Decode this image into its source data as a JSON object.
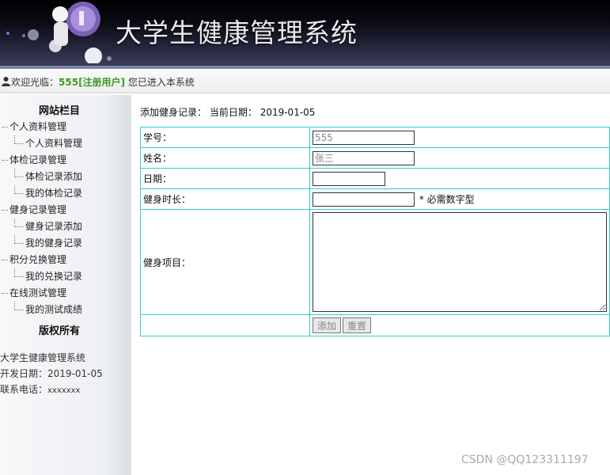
{
  "header": {
    "title": "大学生健康管理系统"
  },
  "welcome": {
    "prefix": "欢迎光临：",
    "user": "555[注册用户]",
    "suffix": " 您已进入本系统"
  },
  "sidebar": {
    "heading": "网站栏目",
    "groups": [
      {
        "label": "个人资料管理",
        "items": [
          "个人资料管理"
        ]
      },
      {
        "label": "体检记录管理",
        "items": [
          "体检记录添加",
          "我的体检记录"
        ]
      },
      {
        "label": "健身记录管理",
        "items": [
          "健身记录添加",
          "我的健身记录"
        ]
      },
      {
        "label": "积分兑换管理",
        "items": [
          "我的兑换记录"
        ]
      },
      {
        "label": "在线测试管理",
        "items": [
          "我的测试成绩"
        ]
      }
    ],
    "copyright_heading": "版权所有",
    "system_name": "大学生健康管理系统",
    "dev_date_label": "开发日期：",
    "dev_date": "2019-01-05",
    "phone_label": "联系电话：",
    "phone": "xxxxxxx"
  },
  "main": {
    "page_title": "添加健身记录：",
    "date_label": "当前日期：",
    "current_date": "2019-01-05",
    "fields": {
      "student_id": {
        "label": "学号：",
        "value": "555"
      },
      "name": {
        "label": "姓名：",
        "value": "张三"
      },
      "date": {
        "label": "日期：",
        "value": ""
      },
      "duration": {
        "label": "健身时长：",
        "value": "",
        "note": "* 必需数字型"
      },
      "project": {
        "label": "健身项目：",
        "value": ""
      }
    },
    "buttons": {
      "add": "添加",
      "reset": "重置"
    }
  },
  "watermark": "CSDN @QQ123311197",
  "colors": {
    "table_border": "#33cccc",
    "username": "#3c9a1e"
  }
}
